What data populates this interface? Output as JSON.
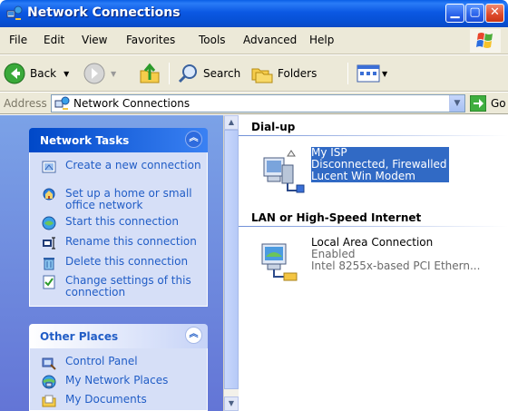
{
  "window": {
    "title": "Network Connections",
    "buttons": [
      "minimize-icon",
      "maximize-icon",
      "close-icon"
    ]
  },
  "menu": {
    "items": [
      "File",
      "Edit",
      "View",
      "Favorites",
      "Tools",
      "Advanced",
      "Help"
    ]
  },
  "toolbar": {
    "back_label": "Back",
    "search_label": "Search",
    "folders_label": "Folders"
  },
  "address": {
    "label": "Address",
    "value": "Network Connections",
    "go_label": "Go"
  },
  "tasks_panel": {
    "title": "Network Tasks",
    "items": [
      {
        "label": "Create a new connection",
        "icon": "new-connection-icon"
      },
      {
        "label": "Set up a home or small office network",
        "icon": "home-network-icon"
      },
      {
        "label": "Start this connection",
        "icon": "start-connection-icon"
      },
      {
        "label": "Rename this connection",
        "icon": "rename-icon"
      },
      {
        "label": "Delete this connection",
        "icon": "delete-icon"
      },
      {
        "label": "Change settings of this connection",
        "icon": "settings-icon"
      }
    ]
  },
  "places_panel": {
    "title": "Other Places",
    "items": [
      {
        "label": "Control Panel",
        "icon": "control-panel-icon"
      },
      {
        "label": "My Network Places",
        "icon": "network-places-icon"
      },
      {
        "label": "My Documents",
        "icon": "documents-icon"
      }
    ]
  },
  "groups": [
    {
      "title": "Dial-up",
      "connections": [
        {
          "name": "My ISP",
          "status": "Disconnected, Firewalled",
          "device": "Lucent Win Modem",
          "selected": true
        }
      ]
    },
    {
      "title": "LAN or High-Speed Internet",
      "connections": [
        {
          "name": "Local Area Connection",
          "status": "Enabled",
          "device": "Intel 8255x-based PCI Ethern...",
          "selected": false
        }
      ]
    }
  ],
  "colors": {
    "titlebar": "#0b58e3",
    "task_link": "#215dc6",
    "selection": "#316ac5",
    "pane_bg": "#6f8fe0"
  }
}
